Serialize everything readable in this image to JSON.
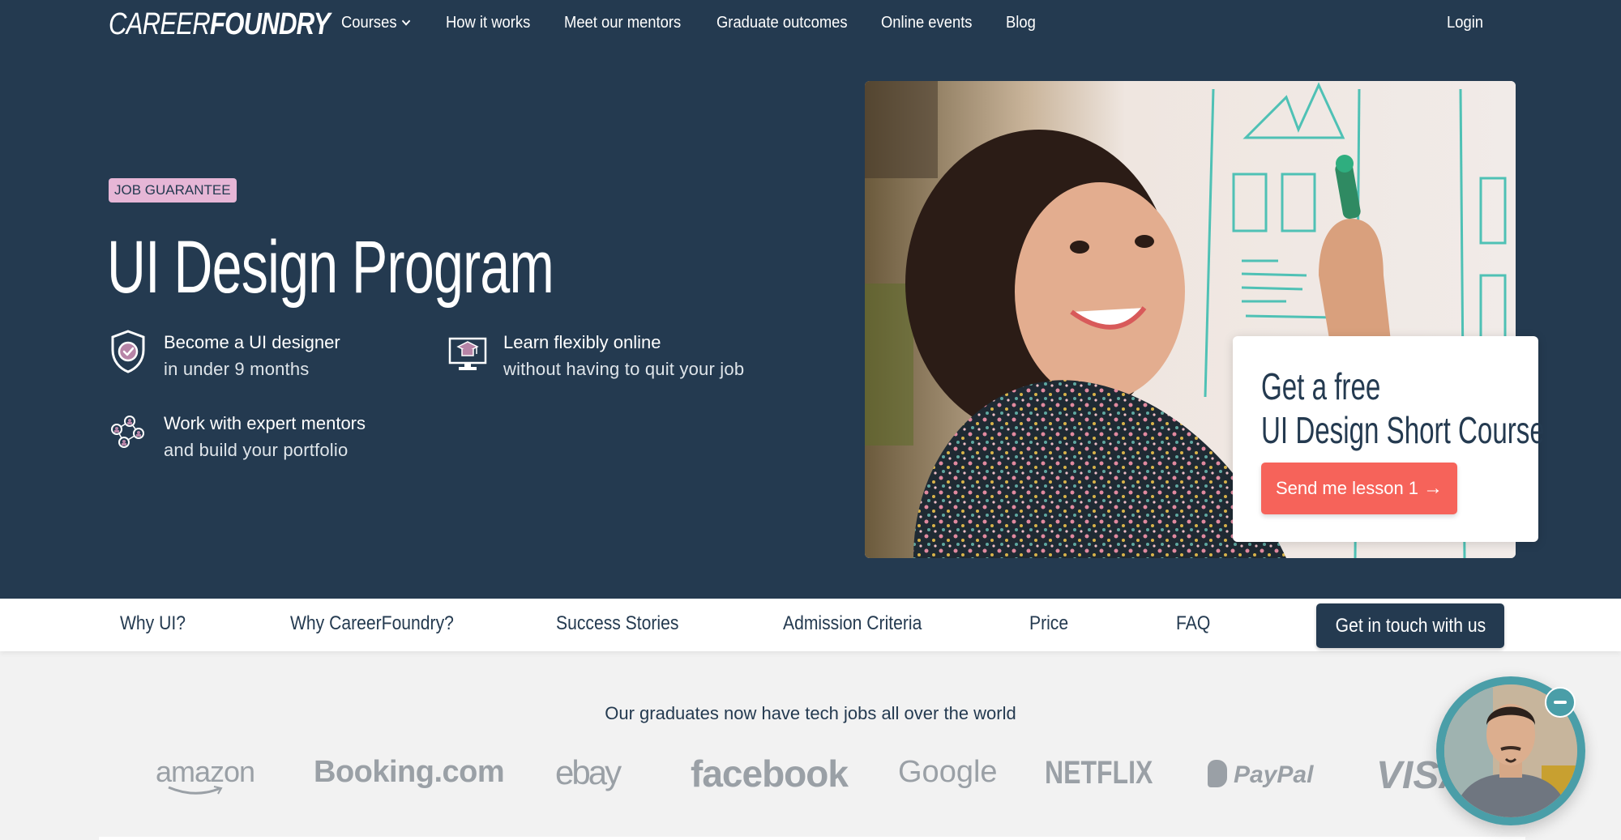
{
  "nav": {
    "logo_light": "CAREER",
    "logo_bold": "FOUNDRY",
    "items": [
      {
        "label": "Courses",
        "has_dropdown": true
      },
      {
        "label": "How it works"
      },
      {
        "label": "Meet our mentors"
      },
      {
        "label": "Graduate outcomes"
      },
      {
        "label": "Online events"
      },
      {
        "label": "Blog"
      }
    ],
    "login": "Login"
  },
  "hero": {
    "badge": "JOB GUARANTEE",
    "title": "UI Design Program",
    "features": [
      {
        "icon": "shield-check-icon",
        "line1": "Become a UI designer",
        "line2": "in under 9 months"
      },
      {
        "icon": "monitor-graduation-icon",
        "line1": "Learn flexibly online",
        "line2": "without having to quit your job"
      },
      {
        "icon": "mentor-network-icon",
        "line1": "Work with expert mentors",
        "line2": "and build your portfolio"
      }
    ],
    "image_alt": "Woman smiling while sketching UI wireframes on a whiteboard"
  },
  "promo": {
    "title_line1": "Get a free",
    "title_line2": "UI Design Short Course",
    "button": "Send me lesson 1",
    "button_icon": "arrow-right-icon"
  },
  "subnav": {
    "items": [
      "Why UI?",
      "Why CareerFoundry?",
      "Success Stories",
      "Admission Criteria",
      "Price",
      "FAQ"
    ],
    "cta": "Get in touch with us"
  },
  "employers": {
    "tagline": "Our graduates now have tech jobs all over the world",
    "logos": [
      "amazon",
      "Booking.com",
      "ebay",
      "facebook",
      "Google",
      "NETFLIX",
      "PayPal",
      "VISA"
    ]
  },
  "colors": {
    "hero_bg": "#243a50",
    "badge_bg": "#e6b6d6",
    "accent": "#f6635a",
    "chat_ring": "#4a9ea8",
    "icon_accent": "#b784a7"
  }
}
